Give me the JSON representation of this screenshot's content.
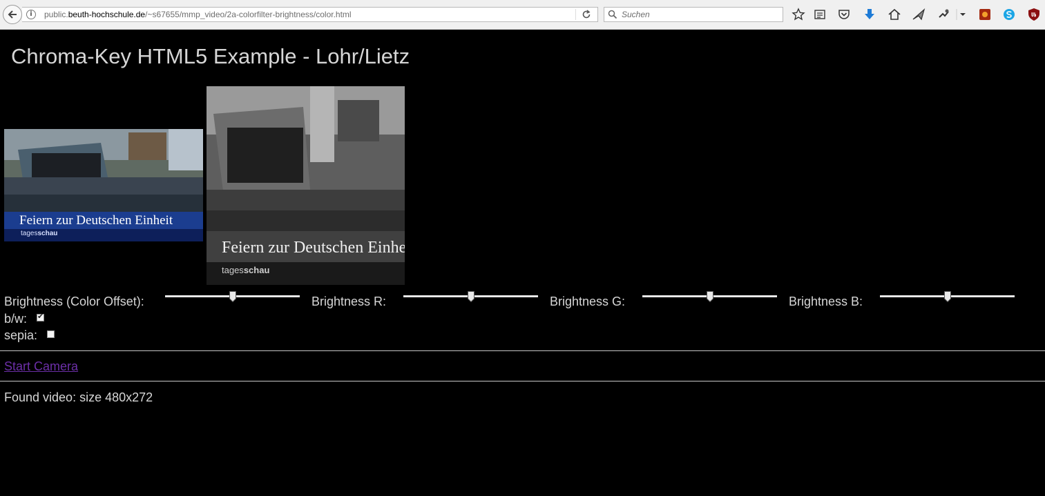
{
  "browser": {
    "url_prefix": "public.",
    "url_domain": "beuth-hochschule.de",
    "url_path": "/~s67655/mmp_video/2a-colorfilter-brightness/color.html",
    "search_placeholder": "Suchen",
    "toolbar_icons": [
      "bookmark-star-icon",
      "reading-list-icon",
      "pocket-icon",
      "download-icon",
      "home-icon",
      "send-icon",
      "extension-icon",
      "menu-dropdown-icon",
      "addon-orange-icon",
      "skype-icon",
      "ublock-icon"
    ]
  },
  "page": {
    "title": "Chroma-Key HTML5 Example - Lohr/Lietz",
    "video_caption": "Feiern zur Deutschen Einheit",
    "video_brand_prefix": "tages",
    "video_brand_suffix": "schau",
    "controls": {
      "brightness_label": "Brightness (Color Offset):",
      "brightness_r_label": "Brightness R:",
      "brightness_g_label": "Brightness G:",
      "brightness_b_label": "Brightness B:",
      "slider_levels": {
        "brightness": 0.5,
        "r": 0.5,
        "g": 0.5,
        "b": 0.5
      },
      "bw_label": "b/w:",
      "bw_checked": true,
      "sepia_label": "sepia:",
      "sepia_checked": false
    },
    "start_camera": "Start Camera",
    "status": "Found video: size 480x272"
  },
  "colors": {
    "background": "#000000",
    "text": "#d6d6d6",
    "visited_link": "#6c2fa8",
    "caption_bar": "#1b3d8f"
  }
}
